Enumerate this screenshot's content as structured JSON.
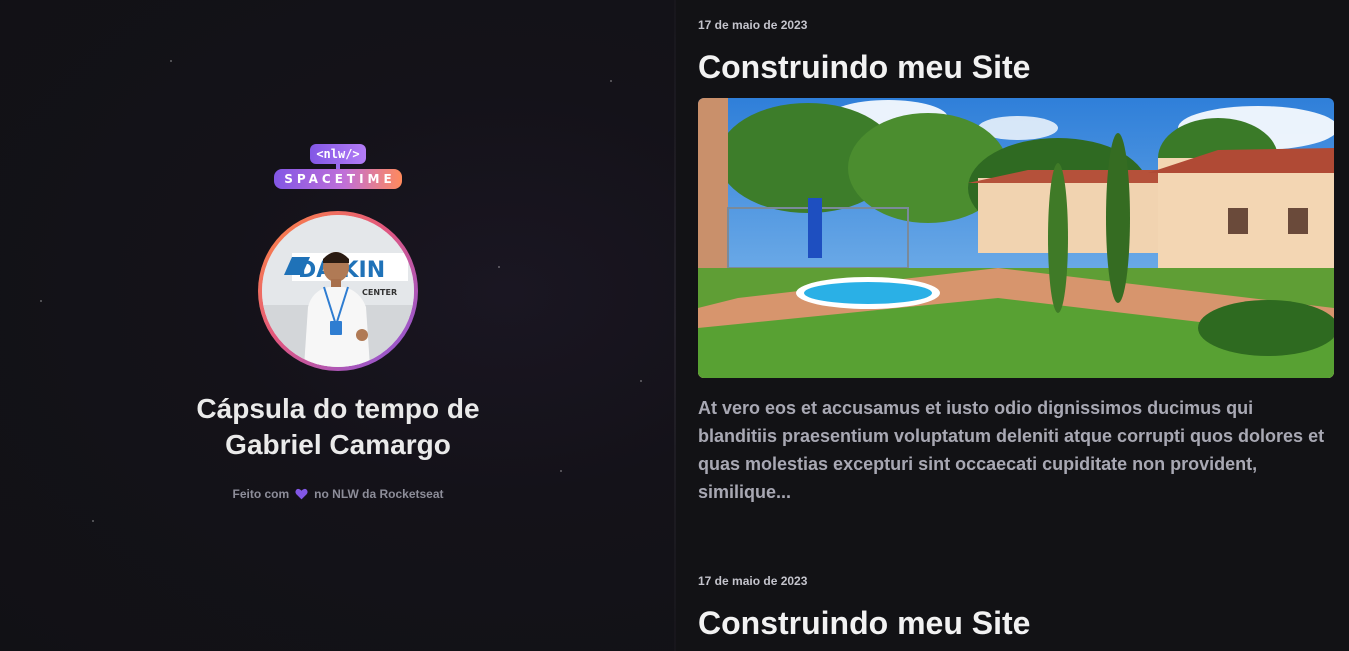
{
  "brand": {
    "tag": "<nlw/>",
    "word": "SPACETIME",
    "colors": {
      "purple": "#8257e5",
      "orange": "#ff8a5c",
      "background": "#121215"
    }
  },
  "profile": {
    "avatar_icon": "user-photo",
    "title_line1": "Cápsula do tempo de",
    "title_line2": "Gabriel Camargo"
  },
  "footer": {
    "prefix": "Feito com",
    "heart_icon": "heart-icon",
    "suffix": "no NLW da Rocketseat"
  },
  "posts": [
    {
      "date": "17 de maio de 2023",
      "title": "Construindo meu Site",
      "excerpt": "At vero eos et accusamus et iusto odio dignissimos ducimus qui blanditiis praesentium voluptatum deleniti atque corrupti quos dolores et quas molestias excepturi sint occaecati cupiditate non provident, similique..."
    },
    {
      "date": "17 de maio de 2023",
      "title": "Construindo meu Site"
    }
  ]
}
